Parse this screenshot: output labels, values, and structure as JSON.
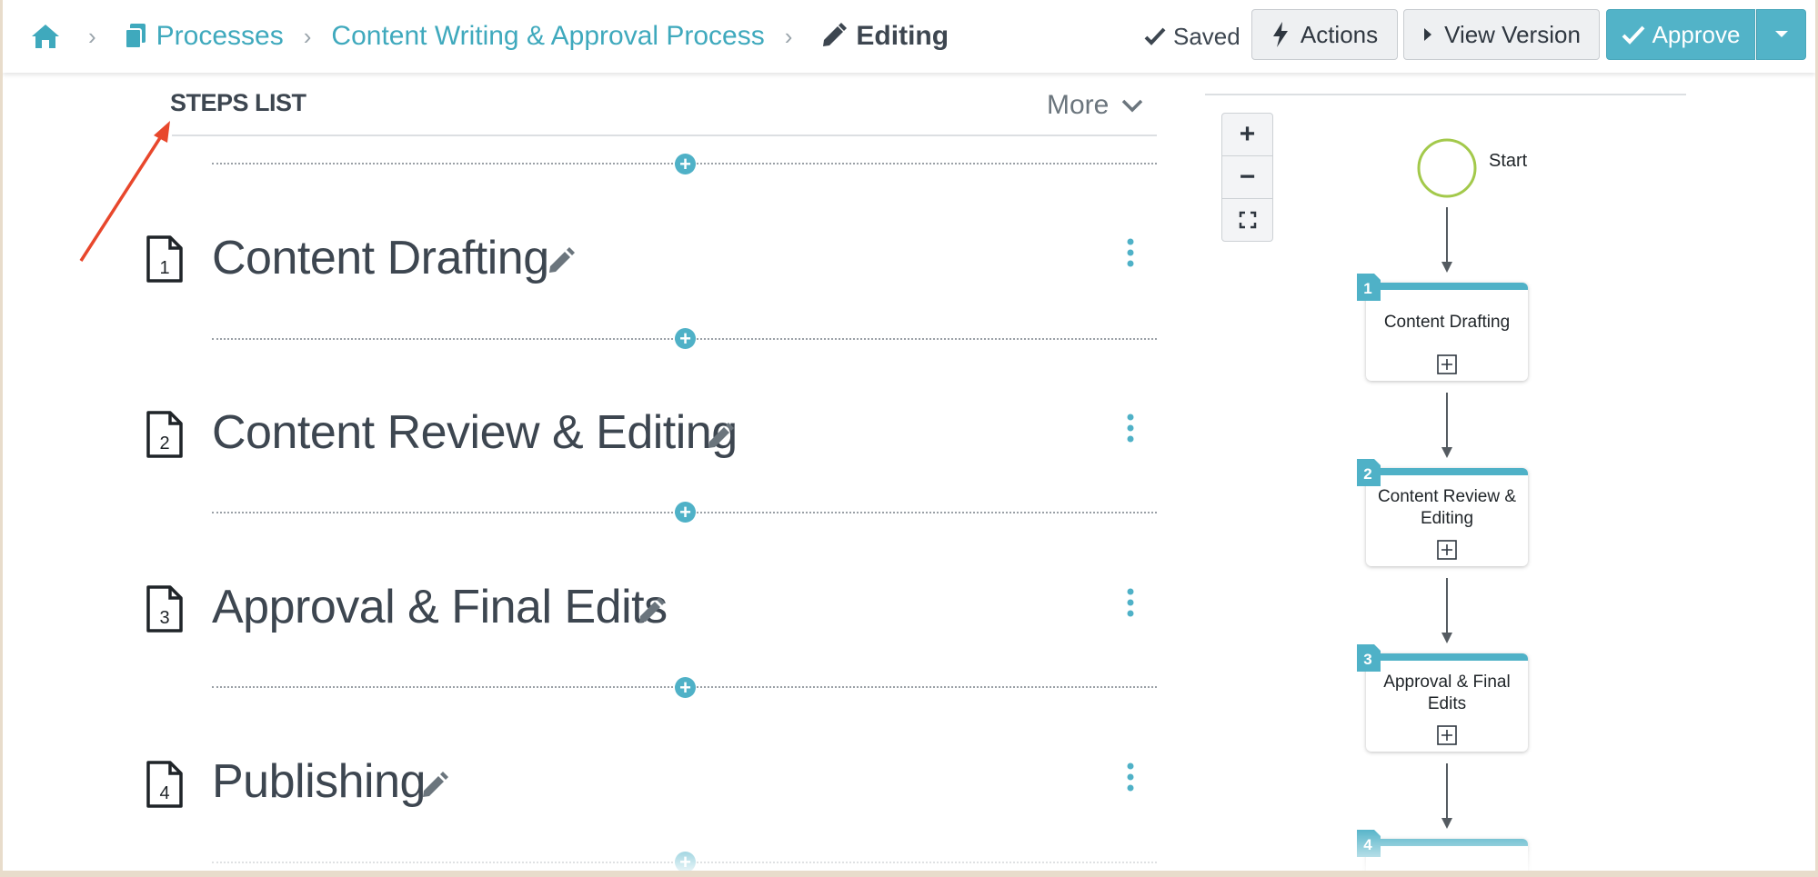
{
  "breadcrumb": {
    "home_icon": "home-icon",
    "processes_label": "Processes",
    "process_name": "Content Writing & Approval Process",
    "current_label": "Editing",
    "separator": "›"
  },
  "toolbar": {
    "saved_label": "Saved",
    "actions_label": "Actions",
    "view_version_label": "View Version",
    "approve_label": "Approve"
  },
  "steps_list": {
    "title": "STEPS LIST",
    "more_label": "More",
    "steps": [
      {
        "number": "1",
        "title": "Content Drafting"
      },
      {
        "number": "2",
        "title": "Content Review & Editing"
      },
      {
        "number": "3",
        "title": "Approval & Final Edits"
      },
      {
        "number": "4",
        "title": "Publishing"
      }
    ]
  },
  "overview": {
    "start_label": "Start",
    "zoom_in": "+",
    "zoom_out": "−",
    "nodes": [
      {
        "number": "1",
        "label": "Content Drafting"
      },
      {
        "number": "2",
        "label": "Content Review & Editing"
      },
      {
        "number": "3",
        "label": "Approval & Final Edits"
      },
      {
        "number": "4",
        "label": ""
      }
    ]
  },
  "colors": {
    "accent": "#4fb1c7",
    "link": "#3fa9bd",
    "text_dark": "#3d4650",
    "annotation_arrow": "#e8472c",
    "start_circle": "#a3c94b"
  }
}
